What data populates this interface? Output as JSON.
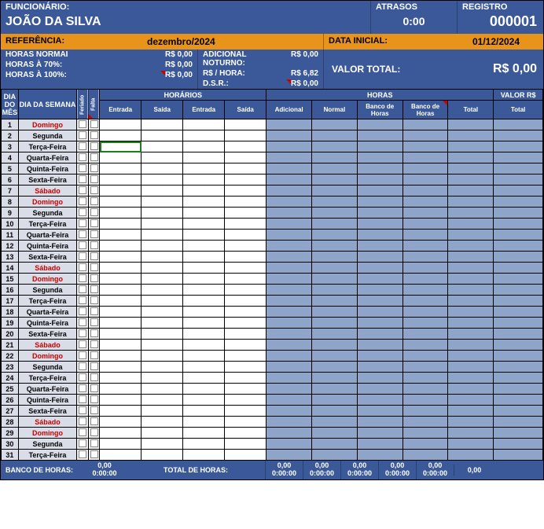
{
  "header": {
    "func_label": "FUNCIONÁRIO:",
    "func_name": "JOÃO DA SILVA",
    "atrasos_label": "ATRASOS",
    "atrasos_value": "0:00",
    "registro_label": "REGISTRO",
    "registro_value": "000001"
  },
  "ref": {
    "ref_label": "REFERÊNCIA:",
    "ref_value": "dezembro/2024",
    "data_inicial_label": "DATA INICIAL:",
    "data_inicial_value": "01/12/2024"
  },
  "info": {
    "horas_normal_label": "HORAS NORMAI",
    "horas_normal_value": "R$ 0,00",
    "horas_70_label": "HORAS À 70%:",
    "horas_70_value": "R$ 0,00",
    "horas_100_label": "HORAS À 100%:",
    "horas_100_value": "R$ 0,00",
    "adicional_noturno_label": "ADICIONAL NOTURNO:",
    "adicional_noturno_value": "R$ 0,00",
    "rs_hora_label": "R$ / HORA:",
    "rs_hora_value": "R$ 6,82",
    "dsr_label": "D.S.R.:",
    "dsr_value": "R$ 0,00",
    "valor_total_label": "VALOR TOTAL:",
    "valor_total_value": "R$ 0,00"
  },
  "thead": {
    "dia_mes": "DIA DO MÊS",
    "dia_semana": "DIA DA SEMANA",
    "feriado": "Feriado",
    "falta": "Falta",
    "horarios": "HORÁRIOS",
    "entrada": "Entrada",
    "saida": "Saída",
    "horas": "HORAS",
    "adicional": "Adicional",
    "normal": "Normal",
    "banco1": "Banco de Horas",
    "banco2": "Banco de Horas",
    "total": "Total",
    "valor_rs": "VALOR R$",
    "total2": "Total"
  },
  "days": [
    {
      "n": "1",
      "dow": "Domingo",
      "red": true
    },
    {
      "n": "2",
      "dow": "Segunda",
      "red": false
    },
    {
      "n": "3",
      "dow": "Terça-Feira",
      "red": false,
      "sel": true
    },
    {
      "n": "4",
      "dow": "Quarta-Feira",
      "red": false
    },
    {
      "n": "5",
      "dow": "Quinta-Feira",
      "red": false
    },
    {
      "n": "6",
      "dow": "Sexta-Feira",
      "red": false
    },
    {
      "n": "7",
      "dow": "Sábado",
      "red": true
    },
    {
      "n": "8",
      "dow": "Domingo",
      "red": true
    },
    {
      "n": "9",
      "dow": "Segunda",
      "red": false
    },
    {
      "n": "10",
      "dow": "Terça-Feira",
      "red": false
    },
    {
      "n": "11",
      "dow": "Quarta-Feira",
      "red": false
    },
    {
      "n": "12",
      "dow": "Quinta-Feira",
      "red": false
    },
    {
      "n": "13",
      "dow": "Sexta-Feira",
      "red": false
    },
    {
      "n": "14",
      "dow": "Sábado",
      "red": true
    },
    {
      "n": "15",
      "dow": "Domingo",
      "red": true
    },
    {
      "n": "16",
      "dow": "Segunda",
      "red": false
    },
    {
      "n": "17",
      "dow": "Terça-Feira",
      "red": false
    },
    {
      "n": "18",
      "dow": "Quarta-Feira",
      "red": false
    },
    {
      "n": "19",
      "dow": "Quinta-Feira",
      "red": false
    },
    {
      "n": "20",
      "dow": "Sexta-Feira",
      "red": false
    },
    {
      "n": "21",
      "dow": "Sábado",
      "red": true
    },
    {
      "n": "22",
      "dow": "Domingo",
      "red": true
    },
    {
      "n": "23",
      "dow": "Segunda",
      "red": false
    },
    {
      "n": "24",
      "dow": "Terça-Feira",
      "red": false
    },
    {
      "n": "25",
      "dow": "Quarta-Feira",
      "red": false
    },
    {
      "n": "26",
      "dow": "Quinta-Feira",
      "red": false
    },
    {
      "n": "27",
      "dow": "Sexta-Feira",
      "red": false
    },
    {
      "n": "28",
      "dow": "Sábado",
      "red": true
    },
    {
      "n": "29",
      "dow": "Domingo",
      "red": true
    },
    {
      "n": "30",
      "dow": "Segunda",
      "red": false
    },
    {
      "n": "31",
      "dow": "Terça-Feira",
      "red": false
    }
  ],
  "footer": {
    "banco_horas_label": "BANCO DE HORAS:",
    "bh_top": "0,00",
    "bh_bot": "0:00:00",
    "total_horas_label": "TOTAL DE HORAS:",
    "c1_top": "0,00",
    "c1_bot": "0:00:00",
    "c2_top": "0,00",
    "c2_bot": "0:00:00",
    "c3_top": "0,00",
    "c3_bot": "0:00:00",
    "c4_top": "0,00",
    "c4_bot": "0:00:00",
    "c5_top": "0,00",
    "c5_bot": "0:00:00",
    "valor": "0,00"
  }
}
